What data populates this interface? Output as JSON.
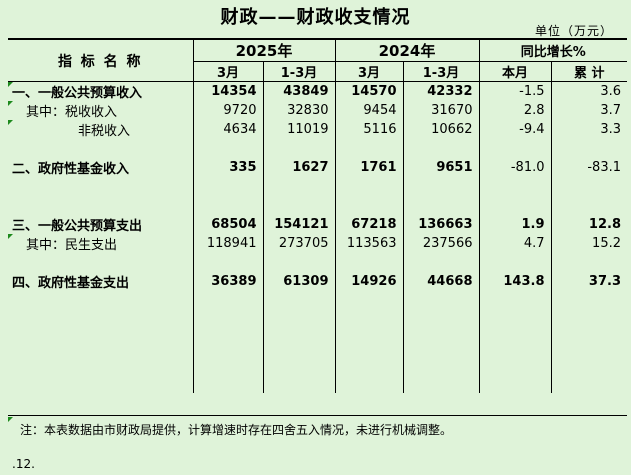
{
  "title": "财政——财政收支情况",
  "unit": "单位（万元）",
  "header": {
    "indicator": "指 标 名 称",
    "year_2025": "2025年",
    "year_2024": "2024年",
    "yoy": "同比增长%",
    "col_mar": "3月",
    "col_q1": "1-3月",
    "col_this_month": "本月",
    "col_cumulative": "累  计"
  },
  "rows": [
    {
      "label": "一、一般公共预算收入",
      "bold": true,
      "v2025_mar": "14354",
      "v2025_q1": "43849",
      "v2024_mar": "14570",
      "v2024_q1": "42332",
      "yoy_month": "-1.5",
      "yoy_cum": "3.6"
    },
    {
      "label": "其中：税收收入",
      "bold": false,
      "v2025_mar": "9720",
      "v2025_q1": "32830",
      "v2024_mar": "9454",
      "v2024_q1": "31670",
      "yoy_month": "2.8",
      "yoy_cum": "3.7"
    },
    {
      "label": "非税收入",
      "bold": false,
      "v2025_mar": "4634",
      "v2025_q1": "11019",
      "v2024_mar": "5116",
      "v2024_q1": "10662",
      "yoy_month": "-9.4",
      "yoy_cum": "3.3"
    },
    {
      "label": "二、政府性基金收入",
      "bold": true,
      "v2025_mar": "335",
      "v2025_q1": "1627",
      "v2024_mar": "1761",
      "v2024_q1": "9651",
      "yoy_month": "-81.0",
      "yoy_cum": "-83.1"
    },
    {
      "label": "三、一般公共预算支出",
      "bold": true,
      "v2025_mar": "68504",
      "v2025_q1": "154121",
      "v2024_mar": "67218",
      "v2024_q1": "136663",
      "yoy_month": "1.9",
      "yoy_cum": "12.8"
    },
    {
      "label": "其中：民生支出",
      "bold": false,
      "v2025_mar": "118941",
      "v2025_q1": "273705",
      "v2024_mar": "113563",
      "v2024_q1": "237566",
      "yoy_month": "4.7",
      "yoy_cum": "15.2"
    },
    {
      "label": "四、政府性基金支出",
      "bold": true,
      "v2025_mar": "36389",
      "v2025_q1": "61309",
      "v2024_mar": "14926",
      "v2024_q1": "44668",
      "yoy_month": "143.8",
      "yoy_cum": "37.3"
    }
  ],
  "note": "注：本表数据由市财政局提供，计算增速时存在四舍五入情况，未进行机械调整。",
  "page_number": ".12.",
  "accent_color": "#1d8a1d"
}
